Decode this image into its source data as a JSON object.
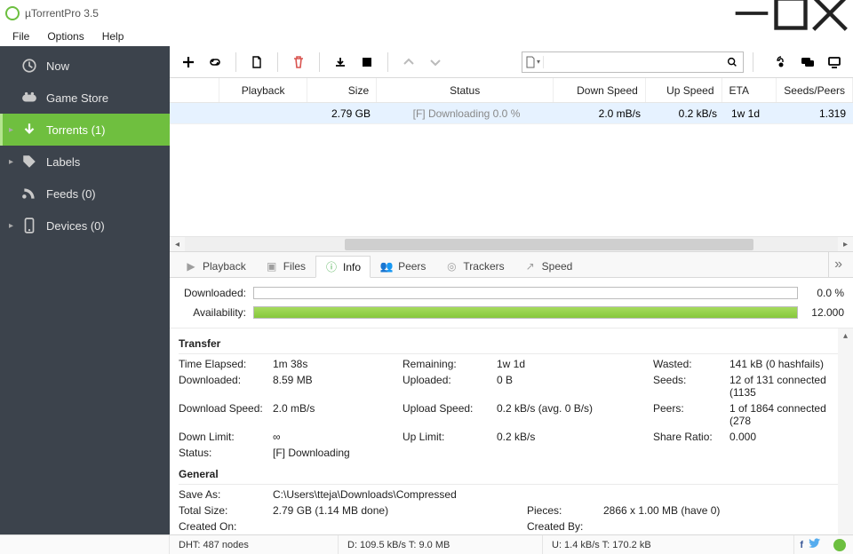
{
  "window": {
    "title": "µTorrentPro 3.5"
  },
  "menubar": {
    "file": "File",
    "options": "Options",
    "help": "Help"
  },
  "sidebar": {
    "items": [
      {
        "label": "Now"
      },
      {
        "label": "Game Store"
      },
      {
        "label": "Torrents (1)"
      },
      {
        "label": "Labels"
      },
      {
        "label": "Feeds (0)"
      },
      {
        "label": "Devices (0)"
      }
    ]
  },
  "columns": {
    "playback": "Playback",
    "size": "Size",
    "status": "Status",
    "down": "Down Speed",
    "up": "Up Speed",
    "eta": "ETA",
    "seeds": "Seeds/Peers"
  },
  "row": {
    "size": "2.79 GB",
    "status": "[F] Downloading 0.0 %",
    "down": "2.0 mB/s",
    "up": "0.2 kB/s",
    "eta": "1w 1d",
    "seeds": "1.319"
  },
  "tabs": {
    "playback": "Playback",
    "files": "Files",
    "info": "Info",
    "peers": "Peers",
    "trackers": "Trackers",
    "speed": "Speed"
  },
  "progress": {
    "downloaded_label": "Downloaded:",
    "downloaded_pct": "0.0 %",
    "availability_label": "Availability:",
    "availability_val": "12.000"
  },
  "transfer": {
    "header": "Transfer",
    "r1": {
      "k1": "Time Elapsed:",
      "v1": "1m 38s",
      "k2": "Remaining:",
      "v2": "1w 1d",
      "k3": "Wasted:",
      "v3": "141 kB (0 hashfails)"
    },
    "r2": {
      "k1": "Downloaded:",
      "v1": "8.59 MB",
      "k2": "Uploaded:",
      "v2": "0 B",
      "k3": "Seeds:",
      "v3": "12 of 131 connected (1135"
    },
    "r3": {
      "k1": "Download Speed:",
      "v1": "2.0 mB/s",
      "k2": "Upload Speed:",
      "v2": "0.2 kB/s (avg. 0 B/s)",
      "k3": "Peers:",
      "v3": "1 of 1864 connected (278"
    },
    "r4": {
      "k1": "Down Limit:",
      "v1": "∞",
      "k2": "Up Limit:",
      "v2": "0.2 kB/s",
      "k3": "Share Ratio:",
      "v3": "0.000"
    },
    "r5": {
      "k1": "Status:",
      "v1": "[F] Downloading"
    }
  },
  "general": {
    "header": "General",
    "r1": {
      "k1": "Save As:",
      "v1": "C:\\Users\\tteja\\Downloads\\Compressed"
    },
    "r2": {
      "k1": "Total Size:",
      "v1": "2.79 GB (1.14 MB done)",
      "k2": "Pieces:",
      "v2": "2866 x 1.00 MB (have 0)"
    },
    "r3": {
      "k1": "Created On:",
      "v1": "",
      "k2": "Created By:",
      "v2": ""
    }
  },
  "statusbar": {
    "dht": "DHT: 487 nodes",
    "down": "D: 109.5 kB/s T: 9.0 MB",
    "up": "U: 1.4 kB/s T: 170.2 kB"
  }
}
